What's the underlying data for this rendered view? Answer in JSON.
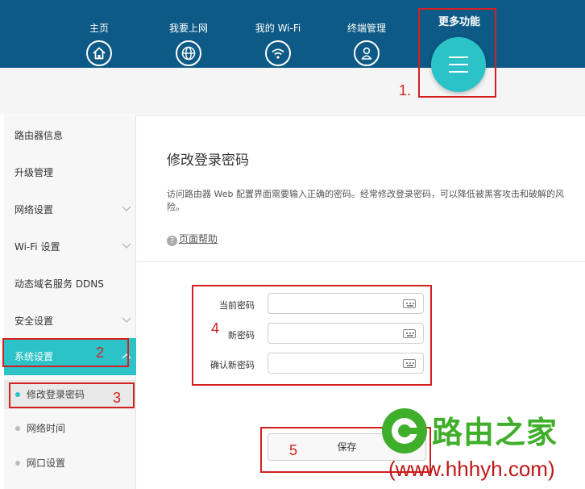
{
  "nav": {
    "items": [
      {
        "label": "主页",
        "icon": "home-icon"
      },
      {
        "label": "我要上网",
        "icon": "globe-icon"
      },
      {
        "label": "我的 Wi-Fi",
        "icon": "wifi-icon"
      },
      {
        "label": "终端管理",
        "icon": "user-icon"
      }
    ],
    "more": {
      "label": "更多功能",
      "icon": "menu-icon"
    }
  },
  "sidebar": {
    "items": [
      {
        "label": "路由器信息"
      },
      {
        "label": "升级管理"
      },
      {
        "label": "网络设置"
      },
      {
        "label": "Wi-Fi 设置"
      },
      {
        "label": "动态域名服务 DDNS"
      },
      {
        "label": "安全设置"
      },
      {
        "label": "系统设置"
      }
    ],
    "subitems": [
      {
        "label": "修改登录密码"
      },
      {
        "label": "网络时间"
      },
      {
        "label": "网口设置"
      }
    ]
  },
  "main": {
    "title": "修改登录密码",
    "description": "访问路由器 Web 配置界面需要输入正确的密码。经常修改登录密码，可以降低被黑客攻击和破解的风险。",
    "help_icon": "?",
    "help_link": "页面帮助",
    "fields": [
      {
        "label": "当前密码",
        "value": ""
      },
      {
        "label": "新密码",
        "value": ""
      },
      {
        "label": "确认新密码",
        "value": ""
      }
    ],
    "save_label": "保存"
  },
  "annotations": [
    "1.",
    "2",
    "3",
    "4",
    "5"
  ],
  "watermark": {
    "name": "路由之家",
    "url": "(www.hhhyh.com)"
  },
  "colors": {
    "nav_bg": "#0d5a86",
    "accent": "#2bc3c8",
    "annotation": "#d42020",
    "watermark_green": "#3fae2a"
  }
}
